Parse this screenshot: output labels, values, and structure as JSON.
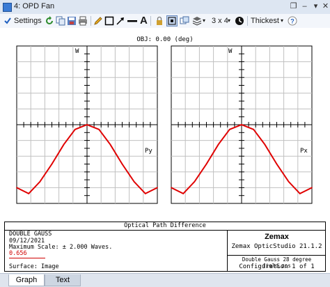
{
  "window": {
    "title": "4: OPD Fan"
  },
  "toolbar": {
    "settings_label": "Settings",
    "layout_label": "3 x 4",
    "line_width_label": "Thickest"
  },
  "plot": {
    "title": "OBJ: 0.00 (deg)",
    "left_panel": {
      "y_label": "W",
      "x_label": "Py"
    },
    "right_panel": {
      "y_label": "W",
      "x_label": "Px"
    },
    "curve_color": "#e00000"
  },
  "chart_data": [
    {
      "type": "line",
      "title": "OBJ: 0.00 (deg)",
      "xlabel": "Py",
      "ylabel": "W",
      "xlim": [
        -1,
        1
      ],
      "ylim": [
        -2,
        2
      ],
      "series": [
        {
          "x": [
            -1.0,
            -0.83,
            -0.67,
            -0.5,
            -0.33,
            -0.17,
            0.0,
            0.17,
            0.33,
            0.5,
            0.67,
            0.83,
            1.0
          ],
          "values": [
            -1.6,
            -1.75,
            -1.45,
            -1.0,
            -0.5,
            -0.12,
            0.0,
            -0.12,
            -0.5,
            -1.0,
            -1.45,
            -1.75,
            -1.6
          ]
        }
      ]
    },
    {
      "type": "line",
      "title": "OBJ: 0.00 (deg)",
      "xlabel": "Px",
      "ylabel": "W",
      "xlim": [
        -1,
        1
      ],
      "ylim": [
        -2,
        2
      ],
      "series": [
        {
          "x": [
            -1.0,
            -0.83,
            -0.67,
            -0.5,
            -0.33,
            -0.17,
            0.0,
            0.17,
            0.33,
            0.5,
            0.67,
            0.83,
            1.0
          ],
          "values": [
            -1.6,
            -1.75,
            -1.45,
            -1.0,
            -0.5,
            -0.12,
            0.0,
            -0.12,
            -0.5,
            -1.0,
            -1.45,
            -1.75,
            -1.6
          ]
        }
      ]
    }
  ],
  "info": {
    "header": "Optical Path Difference",
    "lens_name": "DOUBLE GAUSS",
    "date": "09/12/2021",
    "max_scale": "Maximum Scale: ± 2.000 Waves.",
    "rms_value": "0.656",
    "surface": "Surface: Image",
    "company": "Zemax",
    "product": "Zemax OpticStudio 21.1.2",
    "file": "Double Gauss 28 degree field.zos",
    "configuration": "Configuration 1 of 1"
  },
  "tabs": [
    {
      "label": "Graph",
      "active": true
    },
    {
      "label": "Text",
      "active": false
    }
  ]
}
